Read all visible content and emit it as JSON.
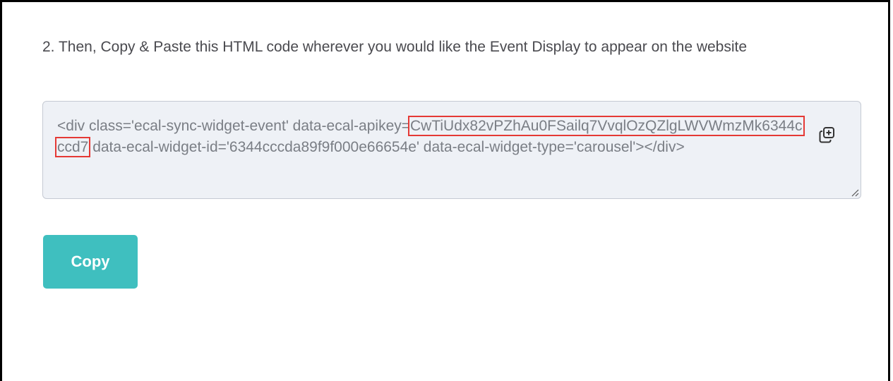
{
  "instruction": "2. Then, Copy & Paste this HTML code wherever you would like the Event Display to appear on the website",
  "code": {
    "before": "<div class='ecal-sync-widget-event' data-ecal-apikey=",
    "highlight": "CwTiUdx82vPZhAu0FSailq7VvqlOzQZlgLWVWmzMk6344cccd7",
    "after": " data-ecal-widget-id='6344cccda89f9f000e66654e' data-ecal-widget-type='carousel'></div>"
  },
  "icons": {
    "copy": "copy-plus-icon",
    "resize": "resize-handle-icon"
  },
  "copy_button": {
    "label": "Copy"
  },
  "colors": {
    "button": "#3fbfbf",
    "highlight_border": "#e53935",
    "code_bg": "#eef1f6"
  }
}
